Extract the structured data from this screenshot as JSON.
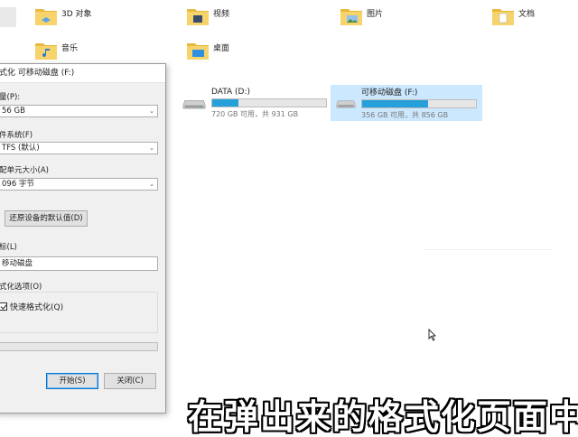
{
  "folders": [
    {
      "label": "3D 对象",
      "icon": "3d-objects-folder-icon"
    },
    {
      "label": "视频",
      "icon": "videos-folder-icon"
    },
    {
      "label": "图片",
      "icon": "pictures-folder-icon"
    },
    {
      "label": "文档",
      "icon": "documents-folder-icon"
    },
    {
      "label": "音乐",
      "icon": "music-folder-icon"
    },
    {
      "label": "桌面",
      "icon": "desktop-folder-icon"
    }
  ],
  "drives": [
    {
      "name": "DATA (D:)",
      "capacity": "720 GB 可用，共 931 GB",
      "used_fraction": 0.23
    },
    {
      "name": "可移动磁盘 (F:)",
      "capacity": "356 GB 可用，共 856 GB",
      "used_fraction": 0.58
    }
  ],
  "dialog": {
    "title": "式化 可移动磁盘 (F:)",
    "capacity_label": "量(P):",
    "capacity_value": "56 GB",
    "fs_label": "件系统(F)",
    "fs_value": "TFS (默认)",
    "alloc_label": "配单元大小(A)",
    "alloc_value": "096 字节",
    "restore_defaults": "还原设备的默认值(D)",
    "volume_label": "标(L)",
    "volume_value": "移动磁盘",
    "format_options_label": "式化选项(O)",
    "quick_format_label": "快速格式化(Q)",
    "quick_format_checked": true,
    "progress": 0,
    "start_button": "开始(S)",
    "close_button": "关闭(C)"
  },
  "subtitle": "在弹出来的格式化页面中",
  "colors": {
    "accent": "#26a0da",
    "selection": "#cce8ff",
    "folder": "#e8b93c"
  }
}
